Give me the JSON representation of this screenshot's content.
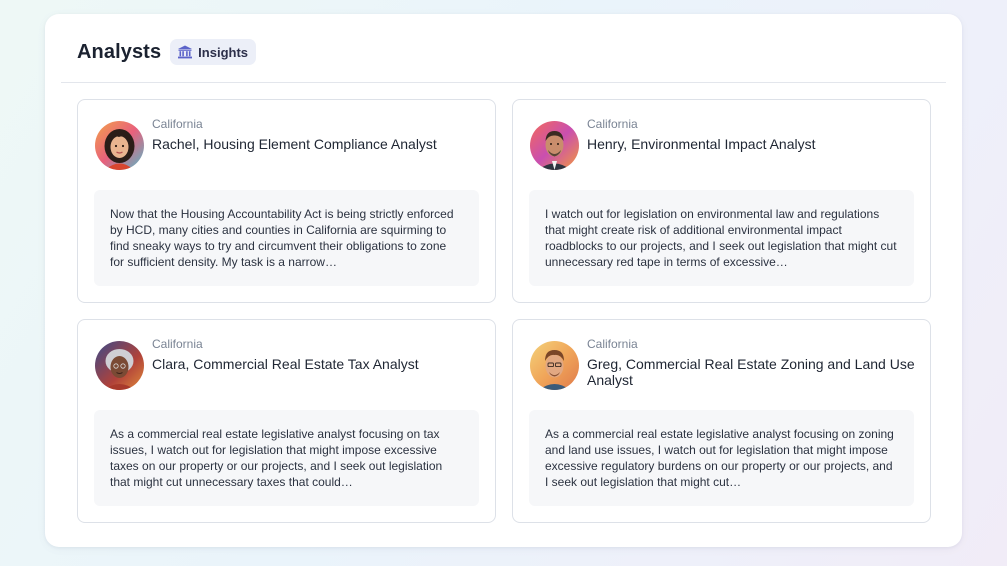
{
  "header": {
    "title": "Analysts",
    "badge_label": "Insights",
    "badge_icon": "institution-icon"
  },
  "cards": [
    {
      "state": "California",
      "name": "Rachel, Housing Element Compliance Analyst",
      "description": "Now that the Housing Accountability Act is being strictly enforced by HCD, many cities and counties in California are squirming to find sneaky ways to try and circumvent their obligations to zone for sufficient density. My task is a narrow…"
    },
    {
      "state": "California",
      "name": "Henry, Environmental Impact Analyst",
      "description": "I watch out for legislation on environmental law and regulations that might create risk of additional environmental impact roadblocks to our projects, and I seek out legislation that might cut unnecessary red tape in terms of excessive…"
    },
    {
      "state": "California",
      "name": "Clara, Commercial Real Estate Tax Analyst",
      "description": "As a commercial real estate legislative analyst focusing on tax issues, I watch out for legislation that might impose excessive taxes on our property or our projects, and I seek out legislation that might cut unnecessary taxes that could…"
    },
    {
      "state": "California",
      "name": "Greg, Commercial Real Estate Zoning and Land Use Analyst",
      "description": "As a commercial real estate legislative analyst focusing on zoning and land use issues, I watch out for legislation that might impose excessive regulatory burdens on our property or our projects, and I seek out legislation that might cut…"
    }
  ],
  "colors": {
    "badge_icon": "#5b63c9",
    "title": "#1b2230",
    "muted": "#7a8494"
  }
}
